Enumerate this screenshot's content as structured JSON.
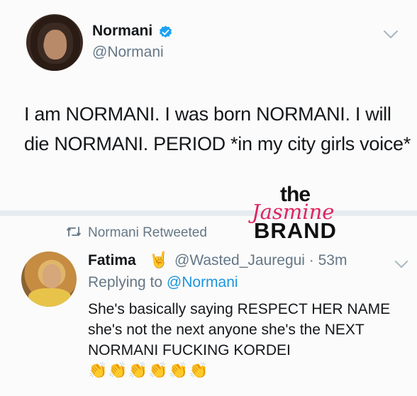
{
  "tweet1": {
    "name": "Normani",
    "handle": "@Normani",
    "text": "I am NORMANI. I was born NORMANI. I will die NORMANI. PERIOD *in my city girls voice*"
  },
  "retweet": {
    "label": "Normani Retweeted"
  },
  "tweet2": {
    "name": "Fatima",
    "name_emoji": "🤘",
    "handle_time": "@Wasted_Jauregui · 53m",
    "replying_prefix": "Replying to",
    "replying_to": "@Normani",
    "text": "She's basically saying RESPECT HER NAME she's not the next anyone she's the NEXT NORMANI FUCKING KORDEI",
    "claps": "👏👏👏👏👏👏"
  },
  "watermark": {
    "the": "the",
    "jasmine": "Jasmine",
    "brand": "BRAND"
  },
  "icons": {
    "verified": "verified-badge-icon",
    "chevron": "chevron-down-icon",
    "retweet": "retweet-icon"
  },
  "colors": {
    "verified": "#1da1f2",
    "secondary_text": "#657786",
    "link": "#1b95e0",
    "watermark_pink": "#e0245e"
  }
}
